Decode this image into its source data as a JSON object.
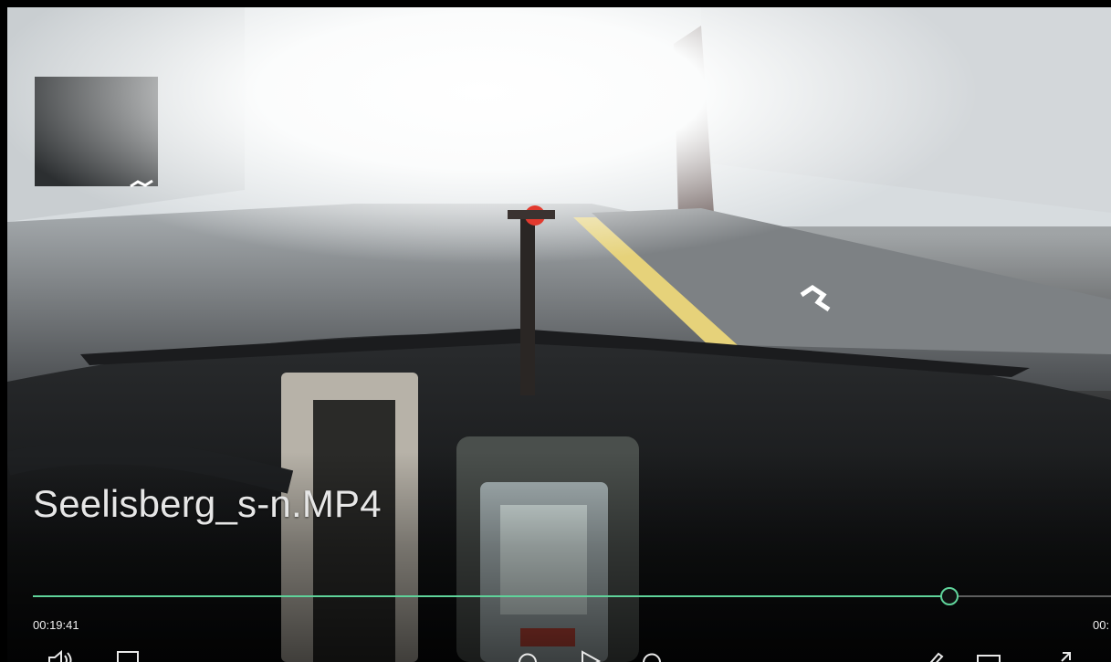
{
  "player": {
    "title": "Seelisberg_s-n.MP4",
    "current_time": "00:19:41",
    "total_time": "00:",
    "progress_fraction": 0.85,
    "accent_color": "#5fd39a"
  },
  "controls": {
    "left": [
      "volume-icon",
      "subtitles-icon"
    ],
    "center": [
      "rewind-icon",
      "play-icon",
      "forward-icon"
    ],
    "right": [
      "edit-icon",
      "mini-view-icon",
      "fullscreen-icon"
    ]
  }
}
